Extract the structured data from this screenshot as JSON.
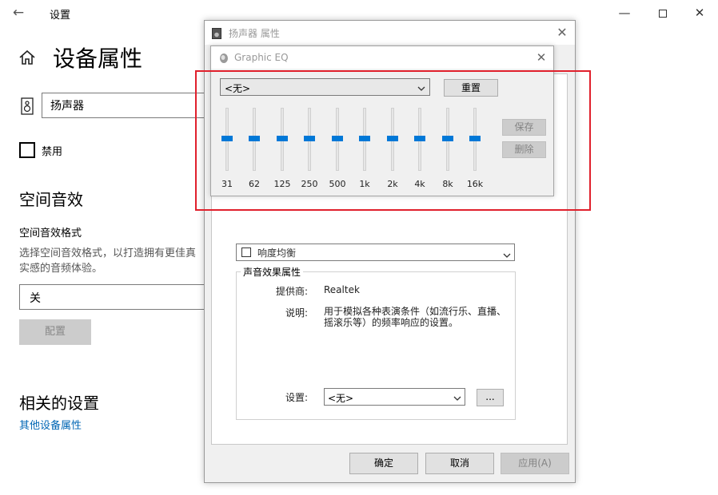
{
  "settings": {
    "title": "设置",
    "heading": "设备属性",
    "device_name": "扬声器",
    "disable_label": "禁用",
    "spatial_section": "空间音效",
    "spatial_format_label": "空间音效格式",
    "spatial_desc": "选择空间音效格式，以打造拥有更佳真实感的音频体验。",
    "spatial_value": "关",
    "config_button": "配置",
    "related_heading": "相关的设置",
    "other_link": "其他设备属性"
  },
  "dialog": {
    "title": "扬声器 属性",
    "environment_value": "响度均衡",
    "effect_group_title": "声音效果属性",
    "provider_label": "提供商:",
    "provider_value": "Realtek",
    "desc_label": "说明:",
    "desc_value": "用于模拟各种表演条件（如流行乐、直播、摇滚乐等）的频率响应的设置。",
    "settings_label": "设置:",
    "settings_value": "<无>",
    "more_button": "...",
    "ok_button": "确定",
    "cancel_button": "取消",
    "apply_button": "应用(A)"
  },
  "eq": {
    "title": "Graphic EQ",
    "preset_value": "<无>",
    "reset_button": "重置",
    "save_button": "保存",
    "delete_button": "删除",
    "bands": [
      {
        "label": "31",
        "level": 0
      },
      {
        "label": "62",
        "level": 0
      },
      {
        "label": "125",
        "level": 0
      },
      {
        "label": "250",
        "level": 0
      },
      {
        "label": "500",
        "level": 0
      },
      {
        "label": "1k",
        "level": 0
      },
      {
        "label": "2k",
        "level": 0
      },
      {
        "label": "4k",
        "level": 0
      },
      {
        "label": "8k",
        "level": 0
      },
      {
        "label": "16k",
        "level": 0
      }
    ]
  },
  "colors": {
    "accent": "#0078d7",
    "highlight": "#e0202c",
    "link": "#0066b4"
  },
  "icons": {
    "back": "back-arrow-icon",
    "home": "home-icon",
    "speaker": "speaker-icon",
    "minimize": "minimize-icon",
    "maximize": "maximize-icon",
    "close": "close-icon"
  }
}
